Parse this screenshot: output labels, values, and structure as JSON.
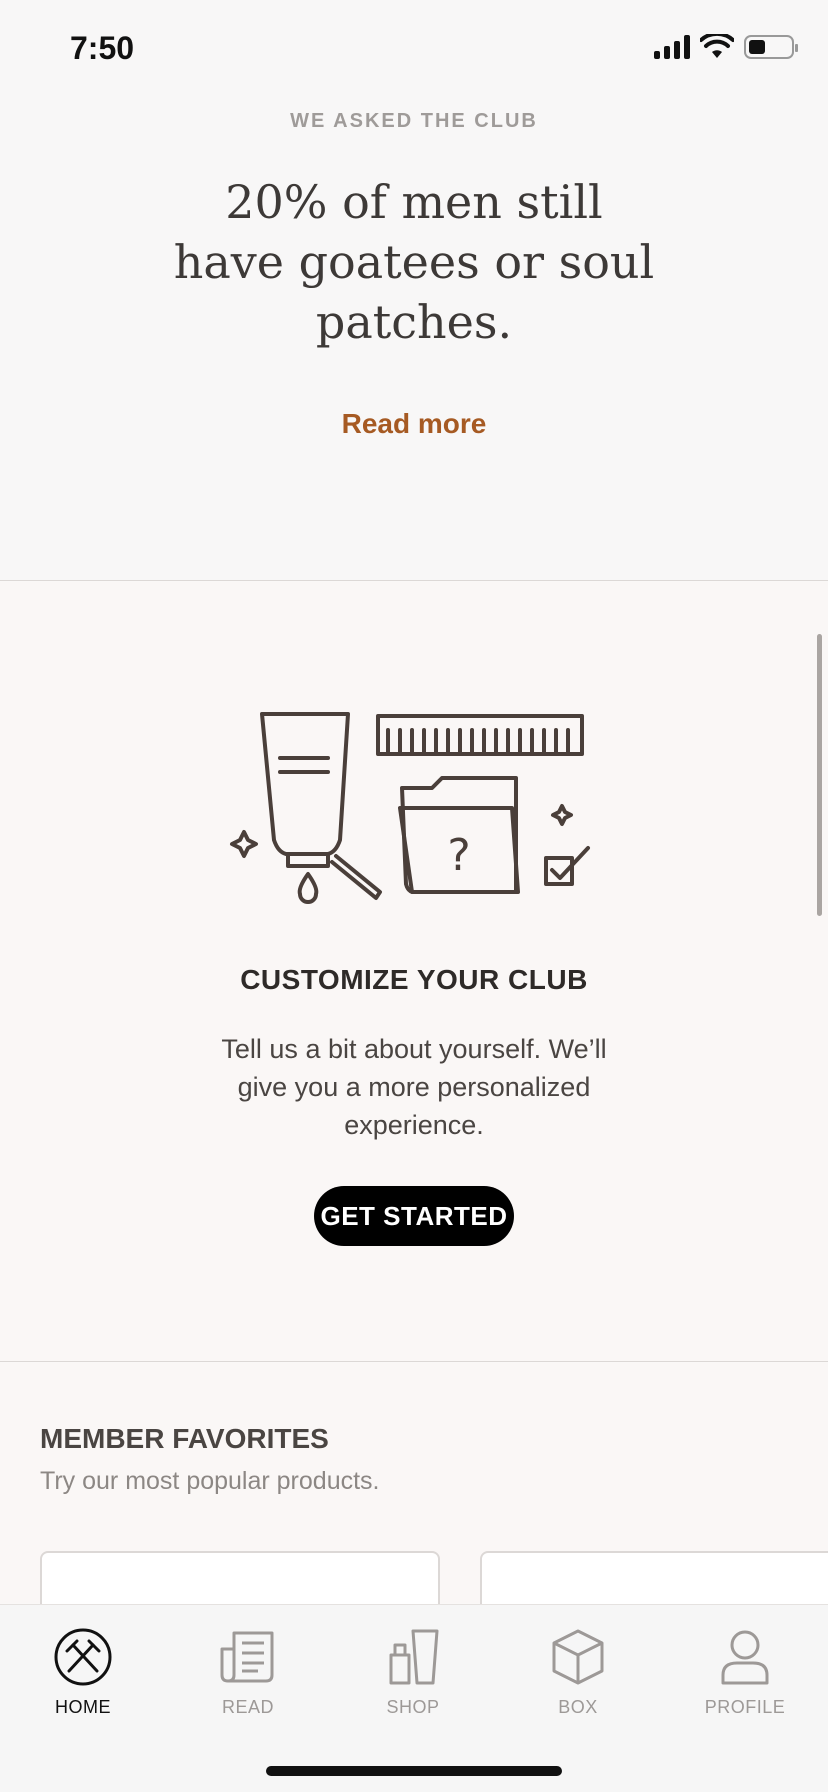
{
  "status_bar": {
    "time": "7:50"
  },
  "ask_section": {
    "eyebrow": "WE ASKED THE CLUB",
    "quote": "20% of men still have goatees or soul patches.",
    "read_more": "Read more"
  },
  "customize": {
    "title": "CUSTOMIZE YOUR CLUB",
    "description": "Tell us a bit about yourself. We’ll give you a more personalized experience.",
    "button_label": "GET STARTED"
  },
  "favorites": {
    "title": "MEMBER FAVORITES",
    "subtitle": "Try our most popular products."
  },
  "tab_bar": {
    "items": [
      {
        "label": "HOME",
        "icon": "home-icon",
        "active": true
      },
      {
        "label": "READ",
        "icon": "read-icon",
        "active": false
      },
      {
        "label": "SHOP",
        "icon": "shop-icon",
        "active": false
      },
      {
        "label": "BOX",
        "icon": "box-icon",
        "active": false
      },
      {
        "label": "PROFILE",
        "icon": "profile-icon",
        "active": false
      }
    ]
  },
  "colors": {
    "accent": "#a65a23",
    "button_bg": "#000000",
    "background": "#faf7f6"
  }
}
